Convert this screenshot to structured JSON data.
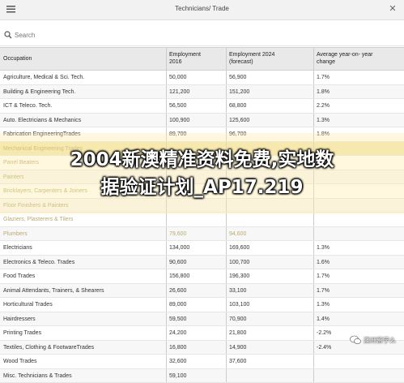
{
  "header": {
    "title": "Technicians/ Trade"
  },
  "search": {
    "placeholder": "Search"
  },
  "table": {
    "columns": [
      "Occupation",
      "Employment\n2016",
      "Employment 2024\n(forecast)",
      "Average year-on- year\nchange"
    ],
    "rows": [
      {
        "occupation": "Agriculture, Medical & Sci. Tech.",
        "emp2016": "50,000",
        "emp2024": "56,900",
        "change": "1.7%"
      },
      {
        "occupation": "Building & Engineering Tech.",
        "emp2016": "121,200",
        "emp2024": "151,200",
        "change": "1.8%"
      },
      {
        "occupation": "ICT & Teleco. Tech.",
        "emp2016": "56,500",
        "emp2024": "68,800",
        "change": "2.2%"
      },
      {
        "occupation": "Auto. Electricians & Mechanics",
        "emp2016": "100,900",
        "emp2024": "125,600",
        "change": "1.3%"
      },
      {
        "occupation": "Fabrication EngineeringTrades",
        "emp2016": "89,700",
        "emp2024": "96,700",
        "change": "1.8%"
      },
      {
        "occupation": "Mechanical Engineering Trades",
        "emp2016": "",
        "emp2024": "",
        "change": ""
      },
      {
        "occupation": "Panel Beaters",
        "emp2016": "",
        "emp2024": "",
        "change": ""
      },
      {
        "occupation": "Painters",
        "emp2016": "",
        "emp2024": "",
        "change": ""
      },
      {
        "occupation": "Bricklayers, Carpenters & Joiners",
        "emp2016": "",
        "emp2024": "",
        "change": ""
      },
      {
        "occupation": "Floor Finishers & Painters",
        "emp2016": "",
        "emp2024": "",
        "change": ""
      },
      {
        "occupation": "Glaziers, Plasterers & Tilers",
        "emp2016": "",
        "emp2024": "",
        "change": ""
      },
      {
        "occupation": "Plumbers",
        "emp2016": "79,600",
        "emp2024": "94,600",
        "change": ""
      },
      {
        "occupation": "Electricians",
        "emp2016": "134,000",
        "emp2024": "169,600",
        "change": "1.3%"
      },
      {
        "occupation": "Electronics & Teleco. Trades",
        "emp2016": "90,600",
        "emp2024": "100,700",
        "change": "1.6%"
      },
      {
        "occupation": "Food Trades",
        "emp2016": "156,800",
        "emp2024": "196,300",
        "change": "1.7%"
      },
      {
        "occupation": "Animal Attendants, Trainers, & Shearers",
        "emp2016": "26,600",
        "emp2024": "33,100",
        "change": "1.7%"
      },
      {
        "occupation": "Horticultural Trades",
        "emp2016": "89,000",
        "emp2024": "103,100",
        "change": "1.3%"
      },
      {
        "occupation": "Hairdressers",
        "emp2016": "59,500",
        "emp2024": "70,900",
        "change": "1.4%"
      },
      {
        "occupation": "Printing Trades",
        "emp2016": "24,200",
        "emp2024": "21,800",
        "change": "-2.2%"
      },
      {
        "occupation": "Textiles, Clothing & FootwareTrades",
        "emp2016": "16,800",
        "emp2024": "14,900",
        "change": "-2.4%"
      },
      {
        "occupation": "Wood Trades",
        "emp2016": "32,600",
        "emp2024": "37,600",
        "change": ""
      },
      {
        "occupation": "Misc. Technicians & Trades",
        "emp2016": "59,100",
        "emp2024": "",
        "change": ""
      }
    ]
  },
  "overlay": {
    "line1": "2004新澳精准资料免费,实地数",
    "line2": "据验证计划_AP17.219"
  },
  "watermark": {
    "text": "澳洲留学么",
    "icon": "wechat-icon"
  },
  "colors": {
    "header_bg": "#e9e9e9",
    "highlight": "#f3e7b4",
    "overlay_text": "#ffffff"
  }
}
